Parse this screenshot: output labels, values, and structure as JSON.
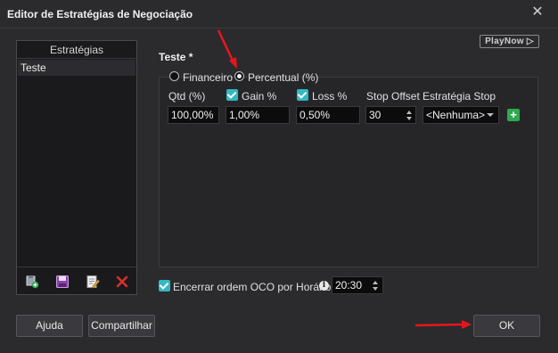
{
  "window": {
    "title": "Editor de Estratégias de Negociação",
    "close_glyph": "✕"
  },
  "left_panel": {
    "header": "Estratégias",
    "items": [
      "Teste"
    ],
    "toolbar_icons": [
      "add-strategy-icon",
      "save-icon",
      "edit-icon",
      "delete-icon"
    ]
  },
  "playnow": {
    "label": "PlayNow ▷"
  },
  "strategy": {
    "title": "Teste *",
    "mode_options": [
      {
        "label": "Financeiro",
        "selected": false
      },
      {
        "label": "Percentual (%)",
        "selected": true
      }
    ],
    "columns": {
      "qty_label": "Qtd (%)",
      "gain_label": "Gain %",
      "loss_label": "Loss %",
      "stop_offset_label": "Stop Offset",
      "stop_strategy_label": "Estratégia Stop"
    },
    "values": {
      "qty": "100,00%",
      "gain": "1,00%",
      "loss": "0,50%",
      "stop_offset": "30",
      "stop_strategy": "<Nenhuma>"
    },
    "plus_glyph": "+"
  },
  "oco": {
    "label": "Encerrar ordem OCO por Horário",
    "checked": true,
    "info_glyph": "i",
    "time": "20:30"
  },
  "buttons": {
    "help": "Ajuda",
    "share": "Compartilhar",
    "ok": "OK"
  },
  "colors": {
    "accent_checkbox": "#35b7c2",
    "annotation_arrow": "#e8161b",
    "add_button": "#2fa84f"
  }
}
